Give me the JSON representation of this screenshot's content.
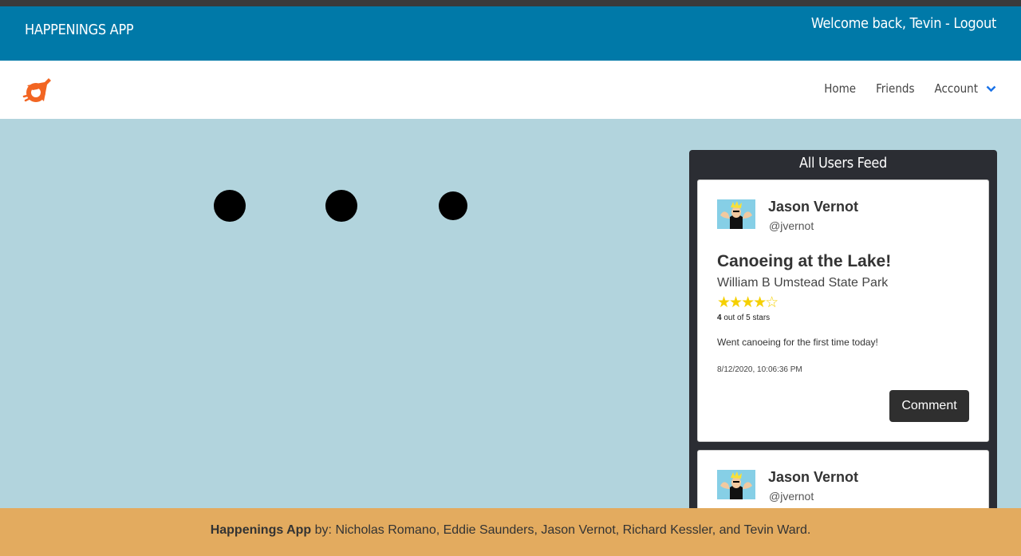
{
  "header": {
    "app_title": "HAPPENINGS APP",
    "welcome_text": "Welcome back, Tevin - ",
    "logout_label": "Logout"
  },
  "nav": {
    "logo_icon": "rocket-logo-icon",
    "home": "Home",
    "friends": "Friends",
    "account": "Account",
    "account_icon": "chevron-down-icon"
  },
  "loader": {
    "dot_count": 3
  },
  "feed": {
    "title": "All Users Feed",
    "posts": [
      {
        "user_name": "Jason Vernot",
        "handle": "@jvernot",
        "title": "Canoeing at the Lake!",
        "location": "William B Umstead State Park",
        "rating": 4,
        "stars": "★★★★☆",
        "rating_number": "4",
        "rating_suffix": " out of 5 stars",
        "text": "Went canoeing for the first time today!",
        "timestamp": "8/12/2020, 10:06:36 PM",
        "comment_label": "Comment"
      },
      {
        "user_name": "Jason Vernot",
        "handle": "@jvernot"
      }
    ]
  },
  "footer": {
    "brand": "Happenings App",
    "credits": " by: Nicholas Romano, Eddie Saunders, Jason Vernot, Richard Kessler, and Tevin Ward."
  },
  "colors": {
    "header_bg": "#0079a8",
    "page_bg": "#b2d4dd",
    "feed_bg": "#2b2d33",
    "footer_bg": "#e3ab5f",
    "star": "#f5d000",
    "logo": "#f26522",
    "accent_chevron": "#1a73e8"
  }
}
